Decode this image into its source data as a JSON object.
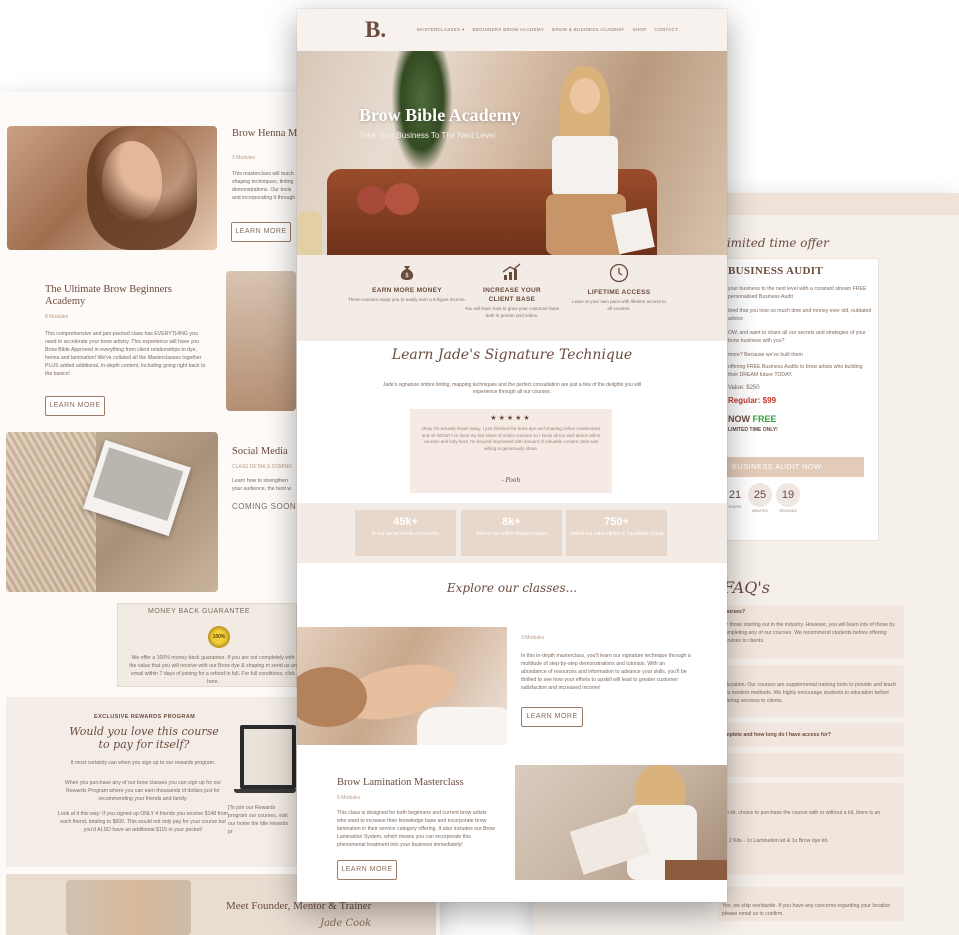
{
  "left": {
    "brow_henna_title": "Brow Henna Masterclass",
    "brow_henna_modules": "3 Modules",
    "brow_henna_desc": "This masterclass will teach shaping techniques, tinting demonstrations. Our tools and incorporating it through",
    "learn_more": "LEARN MORE",
    "beginners_title": "The Ultimate Brow Beginners Academy",
    "beginners_modules": "8 Modules",
    "beginners_desc": "This comprehensive and jam-packed class has EVERYTHING you need to accelerate your brow artistry. This experience will have you Brow Bible Approved in everything from client relationships to dye, henna and lamination! We've collated all the Masterclasses together PLUS added additional, in-depth content, including going right back to the basics!",
    "social_title": "Social Media",
    "social_meta": "CLASS DETAILS COMING",
    "social_desc": "Learn how to strengthen your audience, the best w",
    "coming_soon": "COMING SOON",
    "guarantee_title": "MONEY BACK GUARANTEE",
    "guarantee_badge": "100%",
    "guarantee_text": "We offer a 100% money-back guarantee. If you are not completely with the value that you will receive with our Brow dye & shaping m send us an email within 7 days of joining for a refund in full. For full conditions, click here.",
    "rewards_label": "EXCLUSIVE REWARDS PROGRAM",
    "rewards_heading": "Would you love this course to pay for itself?",
    "rewards_p1": "It most certainly can when you sign up to our rewards program.",
    "rewards_p2": "When you purchase any of our brow classes you can sign up for our Rewards Program where you can earn thousands of dollars just for recommending your friends and family.",
    "rewards_p3": "Look at it this way: If you signed up ONLY 4 friends you receive $148 from each friend, totaling to $600. This would not only pay for your course but you'd ALSO have an additional $115 in your pocket!",
    "rewards_p4": "[To join our Rewards program our courses, visit our home the title rewards pr",
    "founder_title": "Meet Founder, Mentor & Trainer",
    "founder_sig": "Jade Cook"
  },
  "center": {
    "logo": "B.",
    "nav": [
      "MASTERCLASSES ▾",
      "BEGINNERS BROW ACADEMY",
      "BROW & BUSINESS ACADEMY",
      "SHOP",
      "CONTACT"
    ],
    "hero_title": "Brow Bible Academy",
    "hero_subtitle": "Take Your Business To The Next Level",
    "features": [
      {
        "icon": "money-bag-icon",
        "title": "EARN MORE MONEY",
        "desc": "These courses equip you to easily earn a 6-figure income."
      },
      {
        "icon": "growth-chart-icon",
        "title": "INCREASE YOUR CLIENT BASE",
        "desc": "You will learn how to grow your customer base both in person and online."
      },
      {
        "icon": "clock-icon",
        "title": "LIFETIME ACCESS",
        "desc": "Learn at your own pace with lifetime access to all courses."
      }
    ],
    "signature_heading": "Learn Jade's Signature Technique",
    "signature_text": "Jade's signature ombre tinting, mapping techniques and the perfect consultation are just a few of the delights you will experience through all our courses.",
    "testimonial_stars": "★★★★★",
    "testimonial_text": "Okay I'm actually blown away. I just finished the brow dye and shaping online masterclass and oh WOW! I've done my fair share of online courses so I know all too well about online courses and holy heck I'm beyond impressed with amount of valuable content Jade was willing to generously share.",
    "testimonial_author": "- Pooh",
    "stats": [
      {
        "num": "45k+",
        "label": "In our social media community"
      },
      {
        "num": "8k+",
        "label": "Joined our online Masterclasses"
      },
      {
        "num": "750+",
        "label": "Joined our subscription & Facebook Group"
      }
    ],
    "explore_heading": "Explore our classes...",
    "class1_modules": "3 Modules",
    "class1_desc": "In this in-depth masterclass, you'll learn our signature technique through a multitude of step-by-step demonstrations and tutorials. With an abundance of resources and information to advance your skills, you'll be thrilled to see how your efforts to upskill will lead to greater customer satisfaction and increased income!",
    "class1_button": "LEARN MORE",
    "class2_title": "Brow Lamination Masterclass",
    "class2_modules": "6 Modules",
    "class2_desc": "This class is designed for both beginners and current brow artists who want to increase their knowledge base and incorporate brow lamination in their service category offering. It also includes our Brow Lamination System, which means you can incorporate this phenomenal treatment into your business immediately!",
    "class2_button": "LEARN MORE"
  },
  "right": {
    "offer_script": "limited time offer",
    "offer_title": "BUSINESS AUDIT",
    "offer_p1": "your business to the next level with a constant stream FREE personalised Business Audit",
    "offer_p2": "tired that you lose so much time and money ever old, outdated advice",
    "offer_p3": "OW, and want to share all our secrets and strategies of your brow business with you?",
    "offer_p4": "more? Because we've built them",
    "offer_p5": "offering FREE Business Audits to brow artists who building their DREAM future TODAY.",
    "value_label": "Value: $250",
    "regular_label": "Regular: $99",
    "now_label": "NOW",
    "free_label": "FREE",
    "limited_note": "LIMITED TIME ONLY!",
    "cta": "BUSINESS AUDIT NOW",
    "timer": [
      {
        "value": "21",
        "unit": "HOURS"
      },
      {
        "value": "25",
        "unit": "MINUTES"
      },
      {
        "value": "19",
        "unit": "SECONDS"
      }
    ],
    "faq_heading": "FAQ's",
    "faq1_q": "courses?",
    "faq1_a": "for those starting out in the industry. However, you will learn lots of those by completing any of our courses. We recommend students before offering services to clients.",
    "faq2_a": "education. Our courses are supplemental training tools to provide and teach you modern methods. We highly encourage students to education before offering services to clients.",
    "faq3_q": "omplete and how long do I have access for?",
    "faq4_a": "ion kit. choice to purchase the course with or without a kit, there is an",
    "faq5_a": "ke 2 Kits - 1x Lamination kit & 1x Brow dye kit.",
    "faq6_a": "Yes, we ship worldwide. If you have any concerns regarding your location please email us to confirm."
  },
  "colors": {
    "brand_brown": "#6b4b3e",
    "accent_beige": "#e8d8cc",
    "cta_beige": "#e3cbb9",
    "green_free": "#2fa93a",
    "red_price": "#c0392b"
  }
}
